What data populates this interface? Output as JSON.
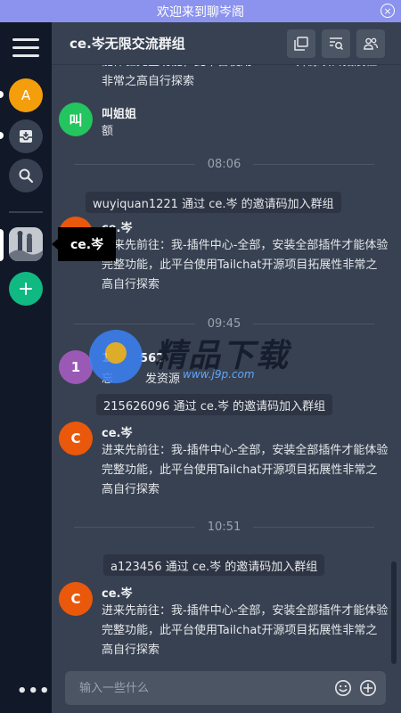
{
  "banner": {
    "text": "欢迎来到聊岑阁",
    "close_symbol": "×"
  },
  "sidebar": {
    "avatar_letter": "A",
    "avatar_color": "#f59e0b",
    "add_color": "#10b981",
    "tooltip": "ce.岑",
    "more": "•••"
  },
  "header": {
    "title": "ce.岑无限交流群组"
  },
  "messages": [
    {
      "body": "能体验完整功能，此平台使用Tailchat开源项目拓展性非常之高自行探索"
    },
    {
      "avatar": "叫",
      "avatar_color": "#22c55e",
      "name": "叫姐姐",
      "body": "额"
    },
    {
      "avatar": "",
      "avatar_color": "#ea580c",
      "name": "ce.岑",
      "body": "进来先前往：我-插件中心-全部，安装全部插件才能体验完整功能，此平台使用Tailchat开源项目拓展性非常之高自行探索"
    },
    {
      "avatar": "1",
      "avatar_color": "#9b59b6",
      "name": "1",
      "name_tail": "562",
      "body": "忘",
      "body_tail": "发资源"
    },
    {
      "avatar": "C",
      "avatar_color": "#ea580c",
      "name": "ce.岑",
      "body": "进来先前往：我-插件中心-全部，安装全部插件才能体验完整功能，此平台使用Tailchat开源项目拓展性非常之高自行探索"
    },
    {
      "avatar": "C",
      "avatar_color": "#ea580c",
      "name": "ce.岑",
      "body": "进来先前往：我-插件中心-全部，安装全部插件才能体验完整功能，此平台使用Tailchat开源项目拓展性非常之高自行探索"
    }
  ],
  "times": [
    "08:06",
    "09:45",
    "10:51"
  ],
  "system": [
    "wuyiquan1221 通过 ce.岑 的邀请码加入群组",
    "215626096 通过 ce.岑 的邀请码加入群组",
    "a123456 通过 ce.岑 的邀请码加入群组"
  ],
  "composer": {
    "placeholder": "输入一些什么"
  },
  "watermark": {
    "text": "精品下载",
    "url": "www.j9p.com"
  }
}
